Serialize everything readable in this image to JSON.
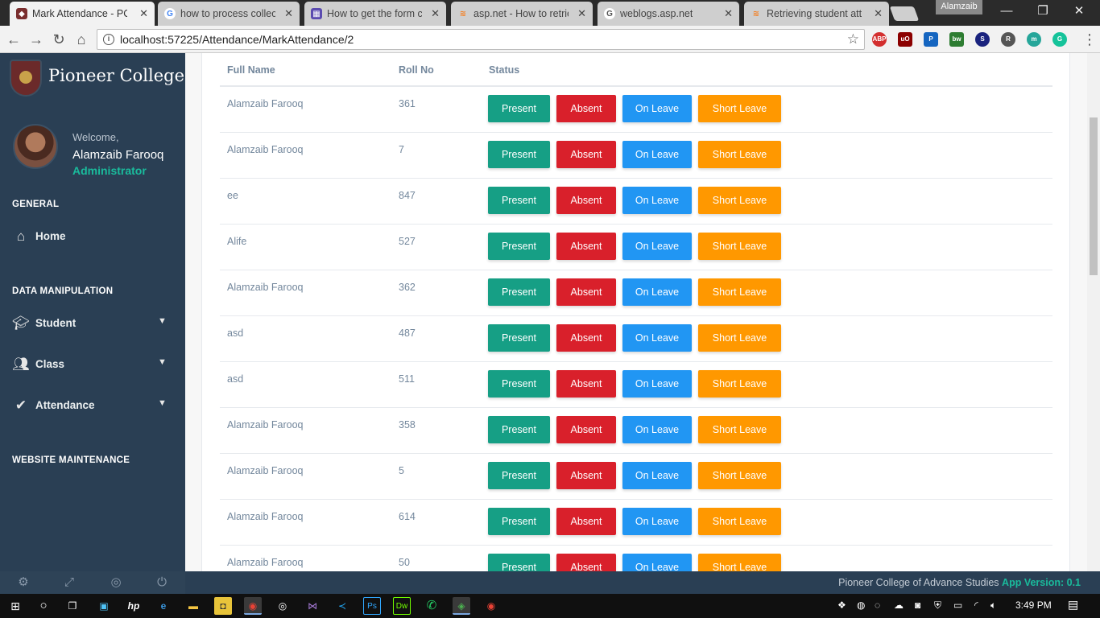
{
  "browser": {
    "tabs": [
      {
        "title": "Mark Attendance - PCA",
        "icon": "college-favicon",
        "active": true
      },
      {
        "title": "how to process collecti",
        "icon": "google-icon",
        "active": false
      },
      {
        "title": "How to get the form c",
        "icon": "grid-favicon",
        "active": false
      },
      {
        "title": "asp.net - How to retrie",
        "icon": "stackoverflow-icon",
        "active": false
      },
      {
        "title": "weblogs.asp.net",
        "icon": "google-icon",
        "active": false
      },
      {
        "title": "Retrieving student atte",
        "icon": "stackoverflow-icon",
        "active": false
      }
    ],
    "profile_name": "Alamzaib",
    "url": "localhost:57225/Attendance/MarkAttendance/2",
    "extensions": [
      "ABP",
      "uO",
      "P",
      "bw",
      "S",
      "R",
      "m",
      "G"
    ]
  },
  "sidebar": {
    "brand": "Pioneer College",
    "welcome": "Welcome,",
    "user_name": "Alamzaib Farooq",
    "role": "Administrator",
    "sections": {
      "general": "GENERAL",
      "data_manipulation": "DATA MANIPULATION",
      "website_maintenance": "WEBSITE MAINTENANCE"
    },
    "items": {
      "home": "Home",
      "student": "Student",
      "class": "Class",
      "attendance": "Attendance"
    }
  },
  "table": {
    "headers": {
      "name": "Full Name",
      "roll": "Roll No",
      "status": "Status"
    },
    "buttons": {
      "present": "Present",
      "absent": "Absent",
      "on_leave": "On Leave",
      "short_leave": "Short Leave"
    },
    "rows": [
      {
        "name": "Alamzaib Farooq",
        "roll": "361"
      },
      {
        "name": "Alamzaib Farooq",
        "roll": "7"
      },
      {
        "name": "ee",
        "roll": "847"
      },
      {
        "name": "Alife",
        "roll": "527"
      },
      {
        "name": "Alamzaib Farooq",
        "roll": "362"
      },
      {
        "name": "asd",
        "roll": "487"
      },
      {
        "name": "asd",
        "roll": "511"
      },
      {
        "name": "Alamzaib Farooq",
        "roll": "358"
      },
      {
        "name": "Alamzaib Farooq",
        "roll": "5"
      },
      {
        "name": "Alamzaib Farooq",
        "roll": "614"
      },
      {
        "name": "Alamzaib Farooq",
        "roll": "50"
      }
    ]
  },
  "footer": {
    "org": "Pioneer College of Advance Studies",
    "version": "App Version: 0.1"
  },
  "taskbar": {
    "time": "3:49 PM"
  },
  "colors": {
    "sidebar_bg": "#2a3f54",
    "accent_green": "#1abb9c",
    "present": "#169f85",
    "absent": "#d9202b",
    "on_leave": "#2196f3",
    "short_leave": "#ff9800"
  }
}
